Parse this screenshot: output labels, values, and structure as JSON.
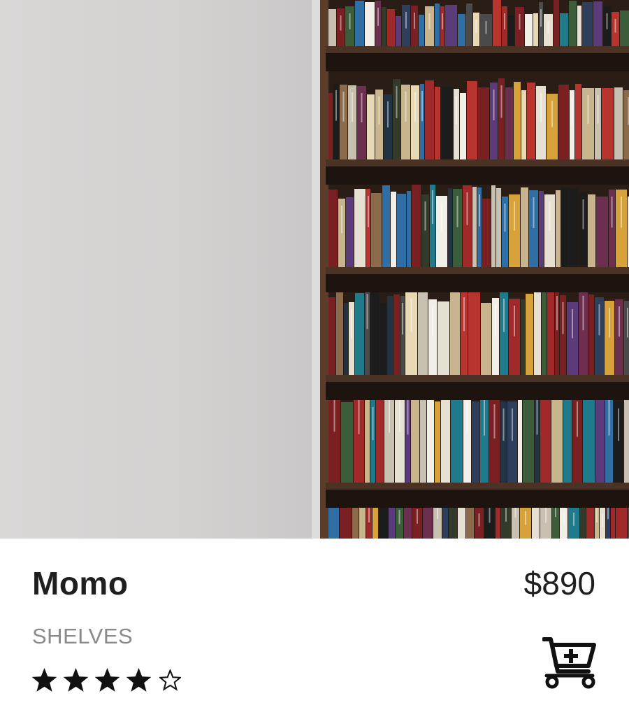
{
  "product": {
    "name": "Momo",
    "price": "$890",
    "category": "SHELVES",
    "rating": 4,
    "rating_max": 5
  },
  "image": {
    "subject": "bookshelf-photo",
    "wall_color": "#d6d4d3",
    "shelf_color": "#4a3324"
  },
  "icons": {
    "star_filled": "star-filled-icon",
    "star_empty": "star-outline-icon",
    "cart": "add-to-cart-icon"
  },
  "colors": {
    "text_primary": "#1f1f1f",
    "text_secondary": "#8a8a8a",
    "icon": "#111111"
  }
}
